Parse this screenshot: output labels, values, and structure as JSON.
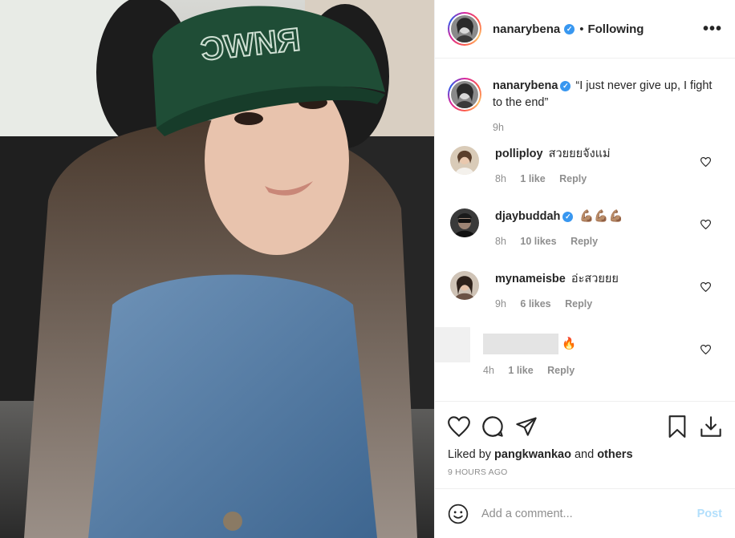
{
  "post": {
    "author": "nanarybena",
    "follow_separator": "•",
    "follow_status": "Following",
    "more_label": "•••",
    "caption": "“I just never give up, I fight to the end”",
    "caption_time": "9h"
  },
  "comments": [
    {
      "user": "polliploy",
      "text": "สวยยยจังแม่",
      "time": "8h",
      "likes": "1 like",
      "reply": "Reply"
    },
    {
      "user": "djaybuddah",
      "text": "💪🏽💪🏽💪🏽",
      "time": "8h",
      "likes": "10 likes",
      "reply": "Reply"
    },
    {
      "user": "mynameisbe",
      "text": "อ่ะสวยยย",
      "time": "9h",
      "likes": "6 likes",
      "reply": "Reply"
    },
    {
      "user": "",
      "text": "🔥",
      "time": "4h",
      "likes": "1 like",
      "reply": "Reply"
    }
  ],
  "liked_by": {
    "prefix": "Liked by",
    "user": "pangkwankao",
    "and": "and",
    "others": "others"
  },
  "timestamp": "9 HOURS AGO",
  "composer": {
    "placeholder": "Add a comment...",
    "post_label": "Post"
  },
  "colors": {
    "verified": "#3897f0",
    "post_disabled": "#b2dffc",
    "meta": "#8e8e8e"
  },
  "icons": [
    "heart-icon",
    "comment-icon",
    "share-icon",
    "bookmark-icon",
    "download-icon",
    "emoji-icon",
    "verified-icon"
  ]
}
